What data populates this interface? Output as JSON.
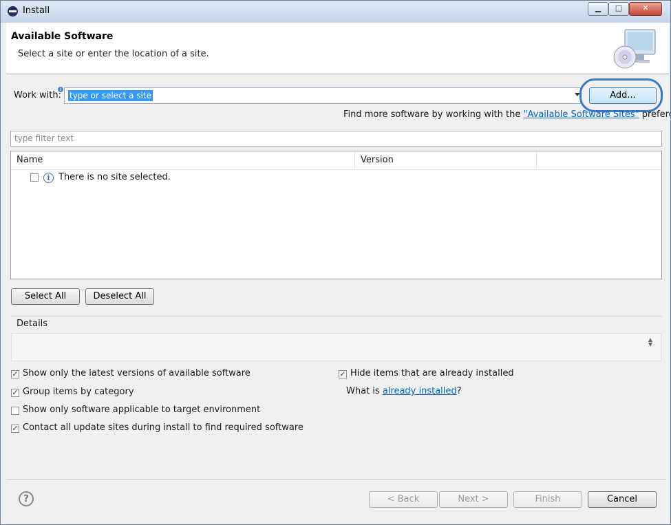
{
  "window": {
    "title": "Install",
    "controls": {
      "minimize": "▁",
      "maximize": "□",
      "close": "✕"
    }
  },
  "header": {
    "title": "Available Software",
    "subtitle": "Select a site or enter the location of a site."
  },
  "work_with": {
    "label": "Work with:",
    "value": "type or select a site",
    "add_button": "Add..."
  },
  "find_more": {
    "prefix": "Find more software by working with the ",
    "link": "\"Available Software Sites\"",
    "suffix": " preferences."
  },
  "filter": {
    "placeholder": "type filter text"
  },
  "table": {
    "columns": [
      "Name",
      "Version"
    ],
    "rows": [
      {
        "name": "There is no site selected.",
        "checked": false
      }
    ]
  },
  "selection_buttons": {
    "select_all": "Select All",
    "deselect_all": "Deselect All"
  },
  "details": {
    "label": "Details"
  },
  "options": {
    "latest_versions": {
      "label": "Show only the latest versions of available software",
      "checked": true
    },
    "group_by_category": {
      "label": "Group items by category",
      "checked": true
    },
    "target_environment": {
      "label": "Show only software applicable to target environment",
      "checked": false
    },
    "contact_sites": {
      "label": "Contact all update sites during install to find required software",
      "checked": true
    },
    "hide_installed": {
      "label": "Hide items that are already installed",
      "checked": true
    },
    "what_is": {
      "prefix": "What is ",
      "link": "already installed",
      "suffix": "?"
    }
  },
  "footer": {
    "help": "?",
    "back": "< Back",
    "next": "Next >",
    "finish": "Finish",
    "cancel": "Cancel"
  },
  "icons": {
    "check": "✓",
    "info": "i",
    "help": "question-icon"
  }
}
